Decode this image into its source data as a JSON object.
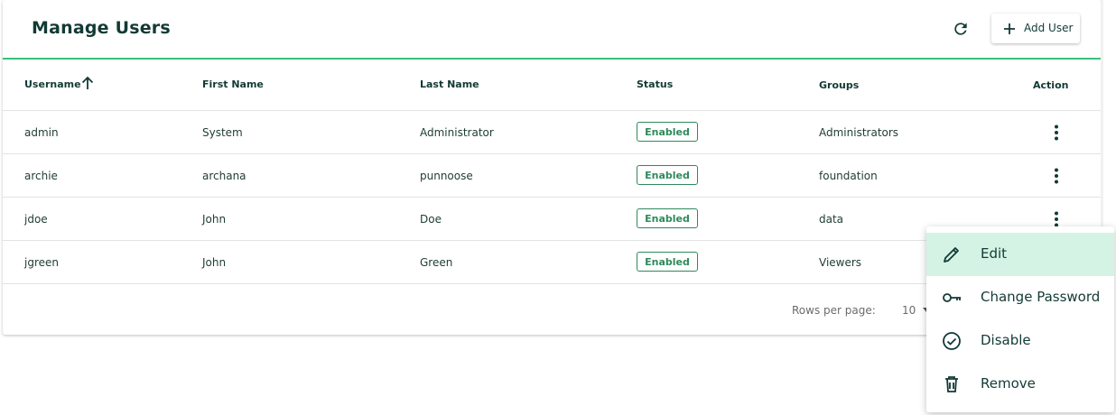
{
  "header": {
    "title": "Manage Users",
    "add_label": "Add User"
  },
  "table": {
    "columns": [
      "Username",
      "First Name",
      "Last Name",
      "Status",
      "Groups",
      "Action"
    ],
    "sort": {
      "column": "Username",
      "direction": "ascending"
    },
    "rows": [
      {
        "username": "admin",
        "first": "System",
        "last": "Administrator",
        "status": "Enabled",
        "group": "Administrators"
      },
      {
        "username": "archie",
        "first": "archana",
        "last": "punnoose",
        "status": "Enabled",
        "group": "foundation"
      },
      {
        "username": "jdoe",
        "first": "John",
        "last": "Doe",
        "status": "Enabled",
        "group": "data"
      },
      {
        "username": "jgreen",
        "first": "John",
        "last": "Green",
        "status": "Enabled",
        "group": "Viewers"
      }
    ]
  },
  "footer": {
    "rows_per_page_label": "Rows per page:",
    "rows_per_page_value": "10"
  },
  "context_menu": {
    "items": [
      {
        "label": "Edit",
        "icon": "pencil-icon"
      },
      {
        "label": "Change Password",
        "icon": "key-icon"
      },
      {
        "label": "Disable",
        "icon": "check-circle-icon"
      },
      {
        "label": "Remove",
        "icon": "trash-icon"
      }
    ]
  },
  "colors": {
    "accent": "#3dbf7e",
    "badge": "#2e8a5c",
    "menu_active": "#d4f3e4",
    "text_dark": "#123a35"
  }
}
